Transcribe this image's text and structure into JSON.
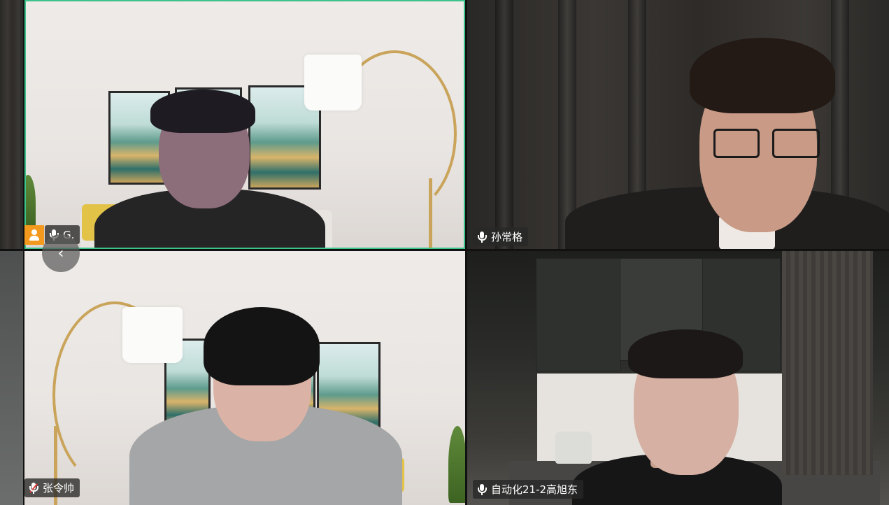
{
  "meeting": {
    "participants": [
      {
        "name": "G.",
        "muted": false,
        "is_host": true,
        "active_speaker": true
      },
      {
        "name": "孙常格",
        "muted": false,
        "is_host": false,
        "active_speaker": false
      },
      {
        "name": "张令帅",
        "muted": true,
        "is_host": false,
        "active_speaker": false
      },
      {
        "name": "自动化21-2高旭东",
        "muted": false,
        "is_host": false,
        "active_speaker": false
      }
    ],
    "controls": {
      "prev_page_icon": "‹"
    }
  },
  "colors": {
    "active_speaker_border": "#3cc28b",
    "host_badge": "#f39a1e",
    "muted_mic": "#e43b3b"
  },
  "icons": {
    "host": "person-icon",
    "mic": "microphone-icon",
    "mic_muted": "microphone-muted-icon",
    "prev": "chevron-left-icon"
  }
}
